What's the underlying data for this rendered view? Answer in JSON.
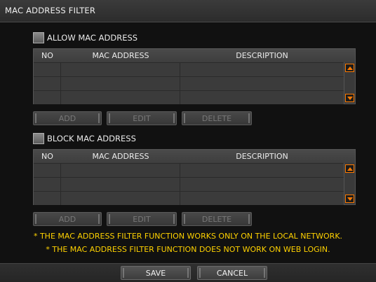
{
  "window": {
    "title": "MAC ADDRESS FILTER"
  },
  "columns": {
    "no": "NO",
    "mac": "MAC ADDRESS",
    "description": "DESCRIPTION"
  },
  "allow_section": {
    "label": "ALLOW MAC ADDRESS",
    "checked": false,
    "buttons": {
      "add": "ADD",
      "edit": "EDIT",
      "delete": "DELETE"
    }
  },
  "block_section": {
    "label": "BLOCK MAC ADDRESS",
    "checked": false,
    "buttons": {
      "add": "ADD",
      "edit": "EDIT",
      "delete": "DELETE"
    }
  },
  "notices": [
    "* THE MAC ADDRESS FILTER FUNCTION WORKS ONLY ON THE LOCAL NETWORK.",
    "* THE MAC ADDRESS FILTER FUNCTION DOES NOT WORK ON WEB LOGIN."
  ],
  "footer": {
    "save": "SAVE",
    "cancel": "CANCEL"
  },
  "colors": {
    "accent": "#ff7a00",
    "notice": "#ffd200"
  },
  "icons": {
    "scroll_up": "arrow-up-icon",
    "scroll_down": "arrow-down-icon"
  }
}
